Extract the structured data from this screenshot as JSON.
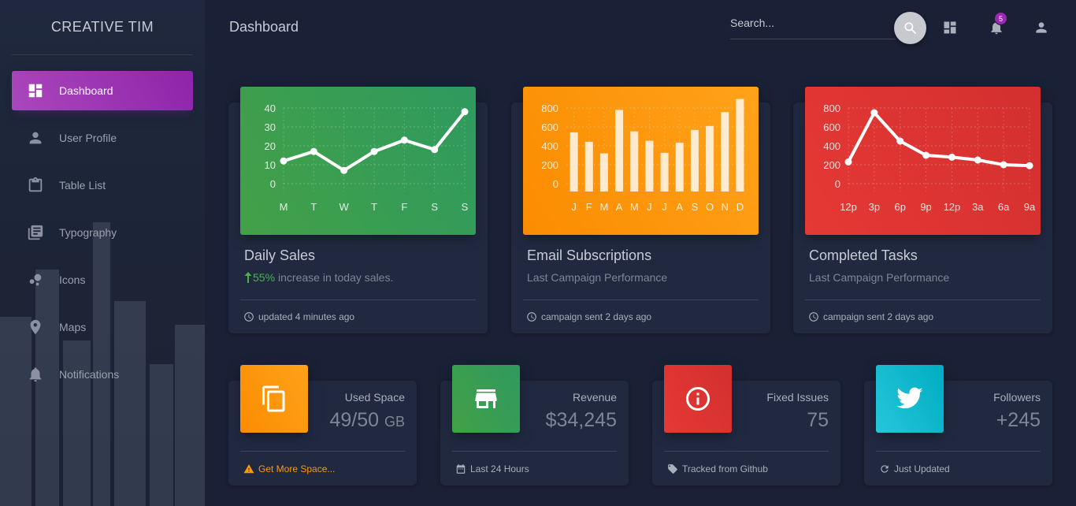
{
  "brand": "CREATIVE TIM",
  "sidebar": {
    "items": [
      {
        "label": "Dashboard",
        "icon": "dashboard-icon",
        "active": true
      },
      {
        "label": "User Profile",
        "icon": "person-icon"
      },
      {
        "label": "Table List",
        "icon": "clipboard-icon"
      },
      {
        "label": "Typography",
        "icon": "library-books-icon"
      },
      {
        "label": "Icons",
        "icon": "bubble-chart-icon"
      },
      {
        "label": "Maps",
        "icon": "location-pin-icon"
      },
      {
        "label": "Notifications",
        "icon": "bell-icon"
      }
    ]
  },
  "navbar": {
    "title": "Dashboard",
    "search_placeholder": "Search...",
    "notification_count": "5"
  },
  "colors": {
    "accent": "#9c27b0",
    "green": "#43a047",
    "orange": "#fb8c00",
    "red": "#e53935",
    "teal": "#00acc1",
    "background": "#1a2035",
    "card": "#202940"
  },
  "cards": [
    {
      "title": "Daily Sales",
      "change": "55%",
      "subtitle": "increase in today sales.",
      "footer": "updated 4 minutes ago"
    },
    {
      "title": "Email Subscriptions",
      "subtitle": "Last Campaign Performance",
      "footer": "campaign sent 2 days ago"
    },
    {
      "title": "Completed Tasks",
      "subtitle": "Last Campaign Performance",
      "footer": "campaign sent 2 days ago"
    }
  ],
  "stats": [
    {
      "label": "Used Space",
      "value": "49/50",
      "unit": "GB",
      "footer": "Get More Space...",
      "icon": "copy-icon"
    },
    {
      "label": "Revenue",
      "value": "$34,245",
      "footer": "Last 24 Hours",
      "icon": "store-icon"
    },
    {
      "label": "Fixed Issues",
      "value": "75",
      "footer": "Tracked from Github",
      "icon": "info-icon"
    },
    {
      "label": "Followers",
      "value": "+245",
      "footer": "Just Updated",
      "icon": "twitter-icon"
    }
  ],
  "chart_data": [
    {
      "type": "line",
      "categories": [
        "M",
        "T",
        "W",
        "T",
        "F",
        "S",
        "S"
      ],
      "values": [
        12,
        17,
        7,
        17,
        23,
        18,
        38
      ],
      "yticks": [
        "40",
        "30",
        "20",
        "10",
        "0"
      ],
      "ylim": [
        0,
        50
      ]
    },
    {
      "type": "bar",
      "categories": [
        "J",
        "F",
        "M",
        "A",
        "M",
        "J",
        "J",
        "A",
        "S",
        "O",
        "N",
        "D"
      ],
      "values": [
        542,
        443,
        320,
        780,
        553,
        453,
        326,
        434,
        568,
        610,
        756,
        895
      ],
      "yticks": [
        "800",
        "600",
        "400",
        "200",
        "0"
      ],
      "ylim": [
        0,
        1000
      ]
    },
    {
      "type": "line",
      "categories": [
        "12p",
        "3p",
        "6p",
        "9p",
        "12p",
        "3a",
        "6a",
        "9a"
      ],
      "values": [
        230,
        750,
        450,
        300,
        280,
        250,
        200,
        190
      ],
      "yticks": [
        "800",
        "600",
        "400",
        "200",
        "0"
      ],
      "ylim": [
        0,
        1000
      ]
    }
  ]
}
